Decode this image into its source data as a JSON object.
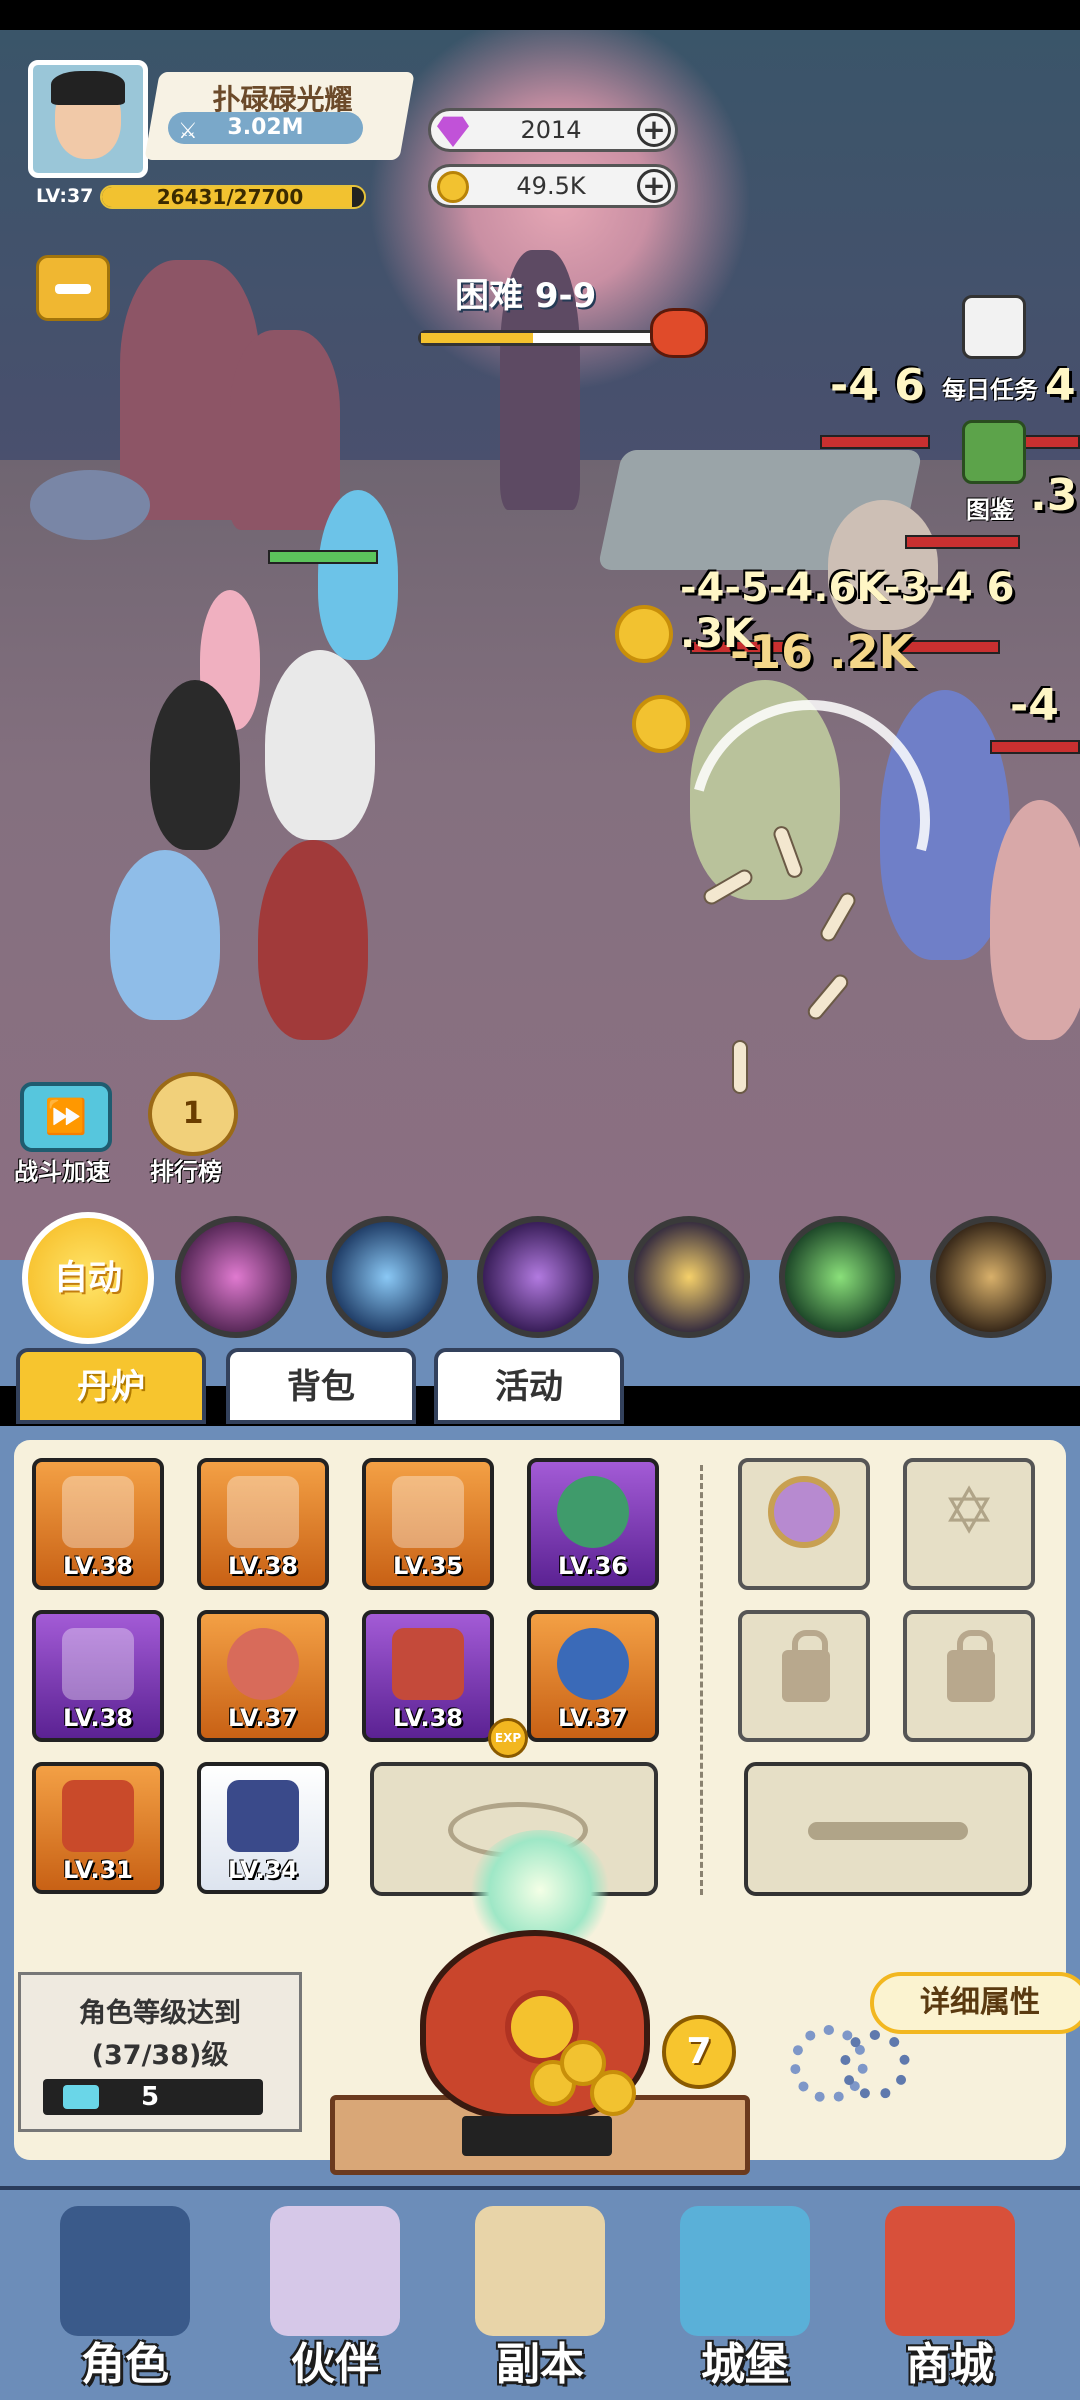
{
  "player": {
    "name": "扑碌碌光耀",
    "power": "3.02M",
    "level": "LV:37",
    "exp_text": "26431/27700",
    "exp_fraction": 0.954
  },
  "currency": [
    {
      "name": "gem",
      "value": "2014",
      "icon": "diamond-icon",
      "color": "#c152d8"
    },
    {
      "name": "coin",
      "value": "49.5K",
      "icon": "coin-icon",
      "color": "#f2c230"
    }
  ],
  "stage": {
    "label": "困难 9-9",
    "progress": 0.48
  },
  "side_buttons": {
    "daily_tasks": "每日任务",
    "codex": "图鉴"
  },
  "damage_numbers": [
    "-4 6",
    "4",
    ".3",
    "-4-5-4.6K-3-4 6 .3K",
    "-16 .2K",
    "-4"
  ],
  "battle_controls": {
    "speed": "战斗加速",
    "ranking": "排行榜",
    "ranking_badge": "1"
  },
  "auto_label": "自动",
  "skills": [
    "vortex-skill",
    "spirit-skill",
    "shadow-skill",
    "thunder-skill",
    "wind-skill",
    "earth-skill"
  ],
  "tabs": [
    "丹炉",
    "背包",
    "活动"
  ],
  "equipment": [
    {
      "level": "LV.38",
      "rarity": "orange",
      "icon": "sword-icon"
    },
    {
      "level": "LV.38",
      "rarity": "orange",
      "icon": "cloak-icon"
    },
    {
      "level": "LV.35",
      "rarity": "orange",
      "icon": "armor-icon"
    },
    {
      "level": "LV.36",
      "rarity": "purple",
      "icon": "jade-orb-icon"
    },
    {
      "level": "LV.38",
      "rarity": "purple",
      "icon": "blade-icon"
    },
    {
      "level": "LV.37",
      "rarity": "orange",
      "icon": "shield-icon"
    },
    {
      "level": "LV.38",
      "rarity": "purple",
      "icon": "bead-whip-icon"
    },
    {
      "level": "LV.37",
      "rarity": "orange",
      "icon": "amulet-icon"
    },
    {
      "level": "LV.31",
      "rarity": "orange",
      "icon": "claw-icon"
    },
    {
      "level": "LV.34",
      "rarity": "white",
      "icon": "boots-icon"
    }
  ],
  "exp_badge": "EXP",
  "requirement": {
    "line1": "角色等级达到",
    "line2": "(37/38)级",
    "ticket_count": "5"
  },
  "detail_button": "详细属性",
  "furnace_badge": "7",
  "nav": [
    "角色",
    "伙伴",
    "副本",
    "城堡",
    "商城"
  ]
}
